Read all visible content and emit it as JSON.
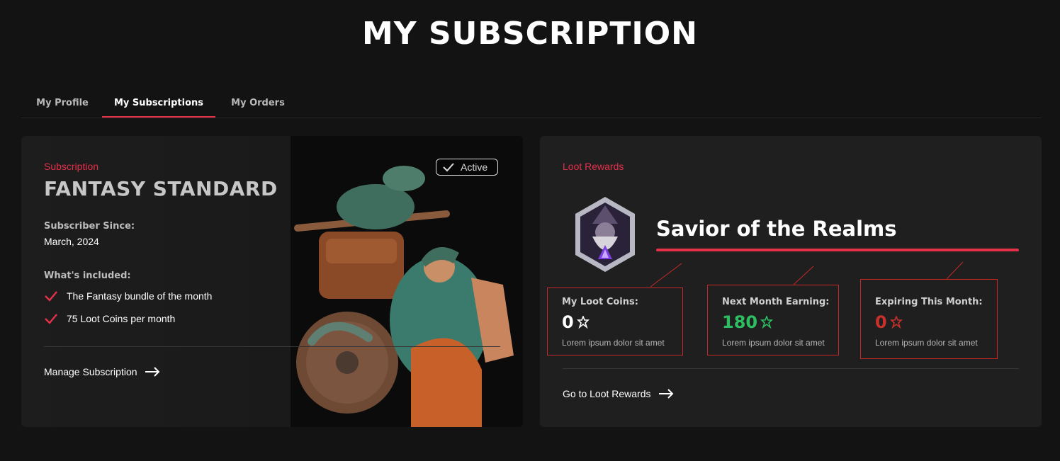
{
  "page": {
    "title": "MY SUBSCRIPTION"
  },
  "tabs": [
    {
      "label": "My Profile"
    },
    {
      "label": "My Subscriptions"
    },
    {
      "label": "My Orders"
    }
  ],
  "subscription": {
    "eyebrow": "Subscription",
    "plan_name": "FANTASY STANDARD",
    "status": "Active",
    "since_label": "Subscriber Since:",
    "since_value": "March, 2024",
    "included_label": "What's included:",
    "included": [
      "The Fantasy bundle of the month",
      "75 Loot Coins per month"
    ],
    "manage_link": "Manage Subscription"
  },
  "rewards": {
    "eyebrow": "Loot Rewards",
    "rank_title": "Savior of the Realms",
    "stats": [
      {
        "label": "My Loot Coins:",
        "value": "0",
        "desc": "Lorem ipsum dolor sit amet",
        "color": "#ffffff"
      },
      {
        "label": "Next Month Earning:",
        "value": "180",
        "desc": "Lorem ipsum dolor sit amet",
        "color": "#2dbe62"
      },
      {
        "label": "Expiring This Month:",
        "value": "0",
        "desc": "Lorem ipsum dolor sit amet",
        "color": "#c9302c"
      }
    ],
    "go_link": "Go to Loot Rewards"
  },
  "colors": {
    "accent": "#e5304a",
    "bg": "#131313",
    "card": "#1f1f1f"
  },
  "icons": [
    "check-icon",
    "arrow-right-icon",
    "loot-coin-icon",
    "wizard-emblem-icon"
  ]
}
